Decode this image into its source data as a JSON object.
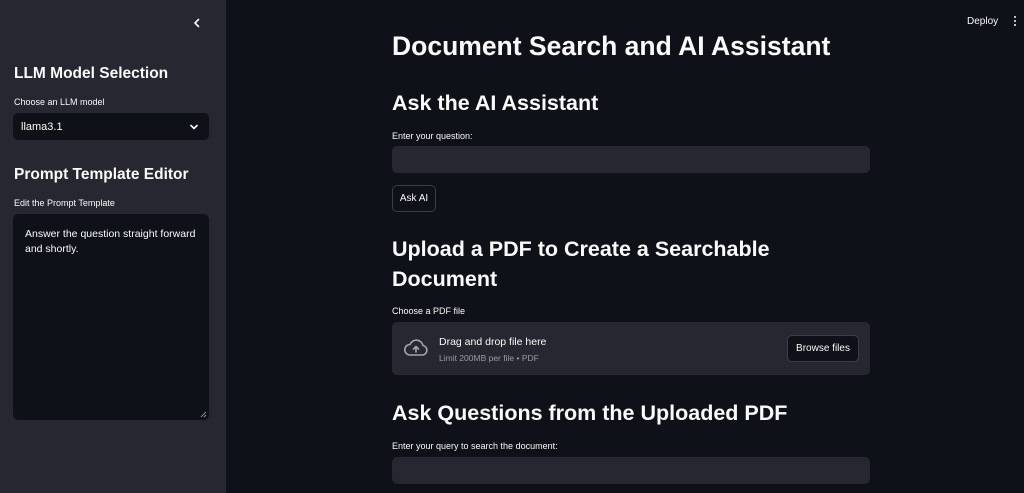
{
  "sidebar": {
    "collapse_icon": "chevron-left-icon",
    "model_section": {
      "heading": "LLM Model Selection",
      "select_label": "Choose an LLM model",
      "selected_value": "llama3.1",
      "dropdown_icon": "chevron-down-icon"
    },
    "prompt_section": {
      "heading": "Prompt Template Editor",
      "textarea_label": "Edit the Prompt Template",
      "textarea_value": "Answer the question straight forward and shortly."
    }
  },
  "header": {
    "deploy_label": "Deploy",
    "menu_icon": "kebab-menu-icon"
  },
  "main": {
    "title": "Document Search and AI Assistant",
    "ask_section": {
      "heading": "Ask the AI Assistant",
      "input_label": "Enter your question:",
      "input_value": "",
      "button_label": "Ask AI"
    },
    "upload_section": {
      "heading_line1": "Upload a PDF to Create a Searchable",
      "heading_line2": "Document",
      "uploader_label": "Choose a PDF file",
      "dropzone_title": "Drag and drop file here",
      "dropzone_limit": "Limit 200MB per file • PDF",
      "dropzone_icon": "cloud-upload-icon",
      "browse_label": "Browse files"
    },
    "query_section": {
      "heading": "Ask Questions from the Uploaded PDF",
      "input_label": "Enter your query to search the document:",
      "input_value": ""
    }
  },
  "colors": {
    "background": "#0e1117",
    "sidebar": "#262730",
    "input_bg": "#262730",
    "text": "#fafafa",
    "muted_text": "#9a9ca5"
  }
}
